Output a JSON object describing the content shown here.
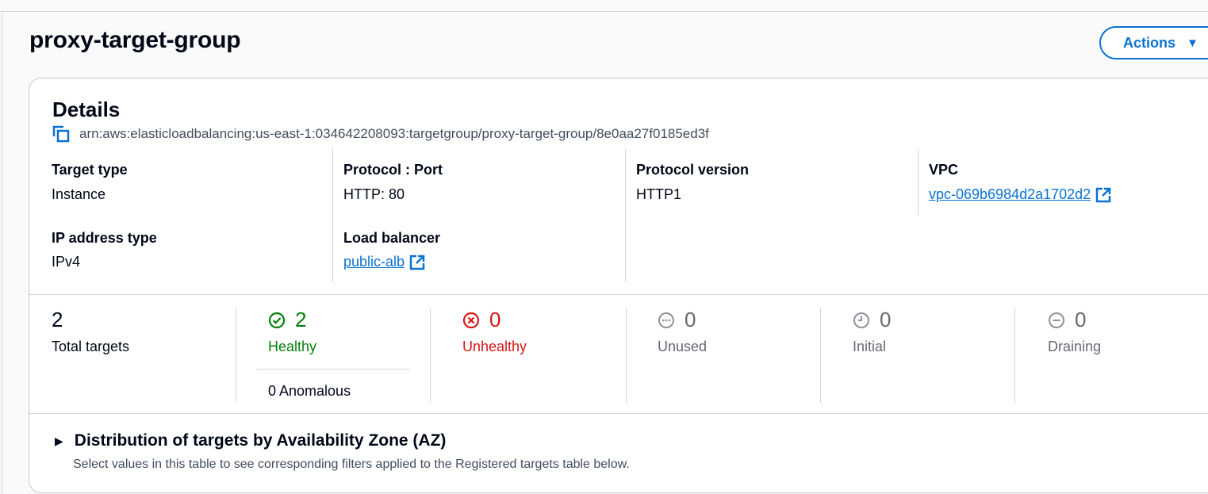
{
  "page": {
    "title": "proxy-target-group",
    "actions_label": "Actions"
  },
  "details": {
    "title": "Details",
    "arn": "arn:aws:elasticloadbalancing:us-east-1:034642208093:targetgroup/proxy-target-group/8e0aa27f0185ed3f",
    "fields": {
      "target_type": {
        "label": "Target type",
        "value": "Instance"
      },
      "protocol_port": {
        "label": "Protocol : Port",
        "value": "HTTP: 80"
      },
      "protocol_version": {
        "label": "Protocol version",
        "value": "HTTP1"
      },
      "vpc": {
        "label": "VPC",
        "value": "vpc-069b6984d2a1702d2"
      },
      "ip_address_type": {
        "label": "IP address type",
        "value": "IPv4"
      },
      "load_balancer": {
        "label": "Load balancer",
        "value": "public-alb"
      }
    }
  },
  "stats": {
    "total": {
      "value": "2",
      "label": "Total targets"
    },
    "healthy": {
      "value": "2",
      "label": "Healthy",
      "icon": "check-circle-icon"
    },
    "anomalous": {
      "label": "0 Anomalous"
    },
    "unhealthy": {
      "value": "0",
      "label": "Unhealthy",
      "icon": "x-circle-icon"
    },
    "unused": {
      "value": "0",
      "label": "Unused",
      "icon": "dots-circle-icon"
    },
    "initial": {
      "value": "0",
      "label": "Initial",
      "icon": "clock-icon"
    },
    "draining": {
      "value": "0",
      "label": "Draining",
      "icon": "minus-circle-icon"
    }
  },
  "distribution": {
    "title": "Distribution of targets by Availability Zone (AZ)",
    "description": "Select values in this table to see corresponding filters applied to the Registered targets table below."
  },
  "colors": {
    "link": "#0972d3",
    "healthy": "#037f0c",
    "unhealthy": "#d91515",
    "neutral": "#656871"
  }
}
